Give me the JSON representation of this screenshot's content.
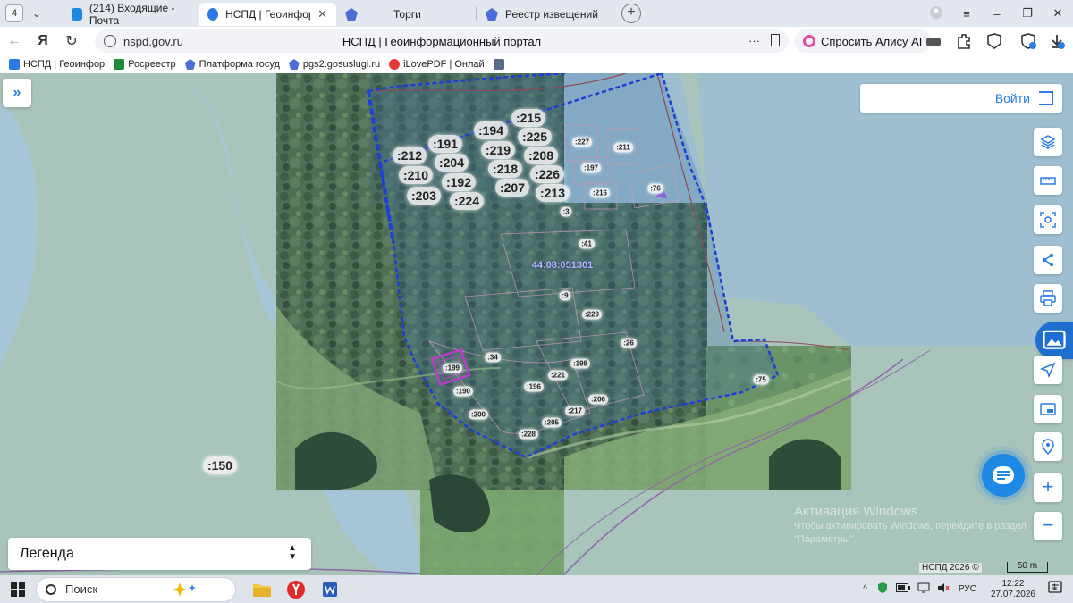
{
  "browser": {
    "tab_count": "4",
    "tabs": [
      {
        "label": "(214) Входящие - Почта",
        "active": false,
        "favicon_color": "#1e88e5"
      },
      {
        "label": "НСПД | Геоинформацио",
        "active": true,
        "favicon_color": "#2a7be4"
      },
      {
        "label": "Торги",
        "active": false,
        "favicon_color": "#4b6fd6"
      },
      {
        "label": "Реестр извещений",
        "active": false,
        "favicon_color": "#4b6fd6"
      }
    ],
    "close_glyph": "✕",
    "new_tab_glyph": "+",
    "address": {
      "host": "nspd.gov.ru",
      "page_title": "НСПД | Геоинформационный портал",
      "dots": "···"
    },
    "alice_label": "Спросить Алису AI",
    "bookmarks": [
      {
        "label": "НСПД | Геоинфор",
        "icon_color": "#2a7be4"
      },
      {
        "label": "Росреестр",
        "icon_color": "#1e8b3a"
      },
      {
        "label": "Платформа госуд",
        "icon_color": "#4b6fd6"
      },
      {
        "label": "pgs2.gosuslugi.ru",
        "icon_color": "#4b6fd6"
      },
      {
        "label": "iLovePDF | Онлай",
        "icon_color": "#e53935"
      },
      {
        "label": "",
        "icon_color": "#5a6b8a"
      }
    ]
  },
  "map": {
    "login_label": "Войти",
    "expand_glyph": "»",
    "legend_label": "Легенда",
    "legend_chevron": "▲▼",
    "zoom_in": "+",
    "zoom_out": "−",
    "quarter_label": "44:08:051301",
    "big_labels": [
      ":215",
      ":194",
      ":225",
      ":191",
      ":219",
      ":208",
      ":212",
      ":204",
      ":218",
      ":226",
      ":210",
      ":192",
      ":207",
      ":213",
      ":203",
      ":224",
      ":150"
    ],
    "small_labels": [
      ":227",
      ":211",
      ":197",
      ":216",
      ":76",
      ":3",
      ":41",
      ":9",
      ":229",
      ":26",
      ":199",
      ":34",
      ":198",
      ":221",
      ":196",
      ":190",
      ":206",
      ":200",
      ":217",
      ":205",
      ":228",
      ":75"
    ],
    "watermark_title": "Активация Windows",
    "watermark_line1": "Чтобы активировать Windows, перейдите в раздел",
    "watermark_line2": "\"Параметры\".",
    "copyright": "НСПД 2026 ©",
    "scale_label": "50 m"
  },
  "taskbar": {
    "search_label": "Поиск",
    "lang": "РУС",
    "time": "12:22",
    "date": "27.07.2026",
    "notification_count": "1"
  }
}
